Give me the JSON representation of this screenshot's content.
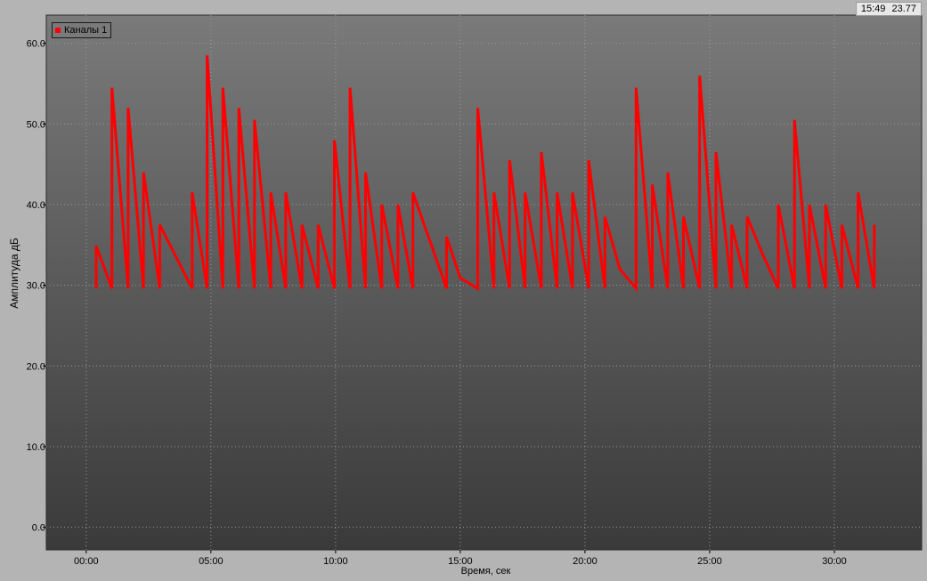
{
  "readout": {
    "time": "15:49",
    "value": "23.77"
  },
  "colors": {
    "series": "#ff0000",
    "grid": "#9a9a9a",
    "plot_top": "#7a7a7a",
    "plot_bottom": "#3a3a3a"
  },
  "chart_data": {
    "type": "line",
    "xlabel": "Время, сек",
    "ylabel": "Амплитуда дБ",
    "xlim": [
      -1.6,
      33.5
    ],
    "ylim": [
      -2.8,
      63.5
    ],
    "grid": true,
    "legend_position": "top-left",
    "y_ticks": [
      0,
      10,
      20,
      30,
      40,
      50,
      60
    ],
    "y_tick_labels": [
      "0.0",
      "10.0",
      "20.0",
      "30.0",
      "40.0",
      "50.0",
      "60.0"
    ],
    "x_ticks": [
      0,
      5,
      10,
      15,
      20,
      25,
      30
    ],
    "x_tick_labels": [
      "00:00",
      "05:00",
      "10:00",
      "15:00",
      "20:00",
      "25:00",
      "30:00"
    ],
    "series": [
      {
        "name": "Каналы 1",
        "color": "#ff0000",
        "x": [
          0.4,
          0.4,
          1.03,
          1.03,
          1.68,
          1.68,
          2.3,
          2.3,
          2.95,
          2.95,
          4.25,
          4.25,
          4.85,
          4.85,
          5.48,
          5.48,
          6.12,
          6.12,
          6.75,
          6.75,
          7.4,
          7.4,
          8.0,
          8.0,
          8.65,
          8.65,
          9.3,
          9.3,
          9.95,
          9.95,
          10.58,
          10.58,
          11.2,
          11.2,
          11.85,
          11.85,
          12.5,
          12.5,
          13.1,
          13.1,
          14.45,
          14.45,
          15.0,
          15.0,
          15.7,
          15.7,
          16.35,
          16.35,
          16.98,
          16.98,
          17.6,
          17.6,
          18.25,
          18.25,
          18.88,
          18.88,
          19.5,
          19.5,
          20.15,
          20.15,
          20.8,
          20.8,
          21.4,
          22.05,
          22.05,
          22.7,
          22.7,
          23.32,
          23.32,
          23.95,
          23.95,
          24.6,
          24.6,
          25.25,
          25.25,
          25.88,
          25.88,
          26.5,
          26.5,
          27.1,
          27.75,
          27.75,
          28.4,
          28.4,
          29.0,
          29.0,
          29.65,
          29.65,
          30.3,
          30.3,
          30.95,
          30.95,
          31.6,
          31.6
        ],
        "y": [
          29.6,
          34.9,
          29.6,
          54.5,
          29.6,
          52.0,
          29.6,
          44.0,
          29.6,
          37.5,
          29.6,
          41.5,
          29.6,
          58.5,
          29.6,
          54.5,
          29.6,
          52.0,
          29.6,
          50.5,
          29.6,
          41.5,
          29.6,
          41.5,
          29.6,
          37.5,
          29.6,
          37.5,
          29.6,
          48.0,
          29.6,
          54.5,
          29.6,
          44.0,
          29.6,
          40.0,
          29.6,
          40.0,
          29.6,
          41.5,
          29.6,
          36.0,
          30.9,
          30.9,
          29.6,
          52.0,
          29.6,
          41.5,
          29.6,
          45.5,
          29.6,
          41.5,
          29.6,
          46.5,
          29.6,
          41.5,
          29.6,
          41.5,
          29.6,
          45.5,
          29.6,
          38.5,
          32.0,
          29.6,
          54.5,
          29.6,
          42.5,
          29.6,
          44.0,
          29.6,
          38.5,
          29.6,
          56.0,
          29.6,
          46.5,
          29.6,
          37.5,
          29.6,
          38.5,
          34.0,
          29.6,
          40.0,
          29.6,
          50.5,
          29.6,
          40.0,
          29.6,
          40.0,
          29.6,
          37.5,
          29.6,
          41.5,
          29.6,
          37.5
        ]
      }
    ]
  }
}
